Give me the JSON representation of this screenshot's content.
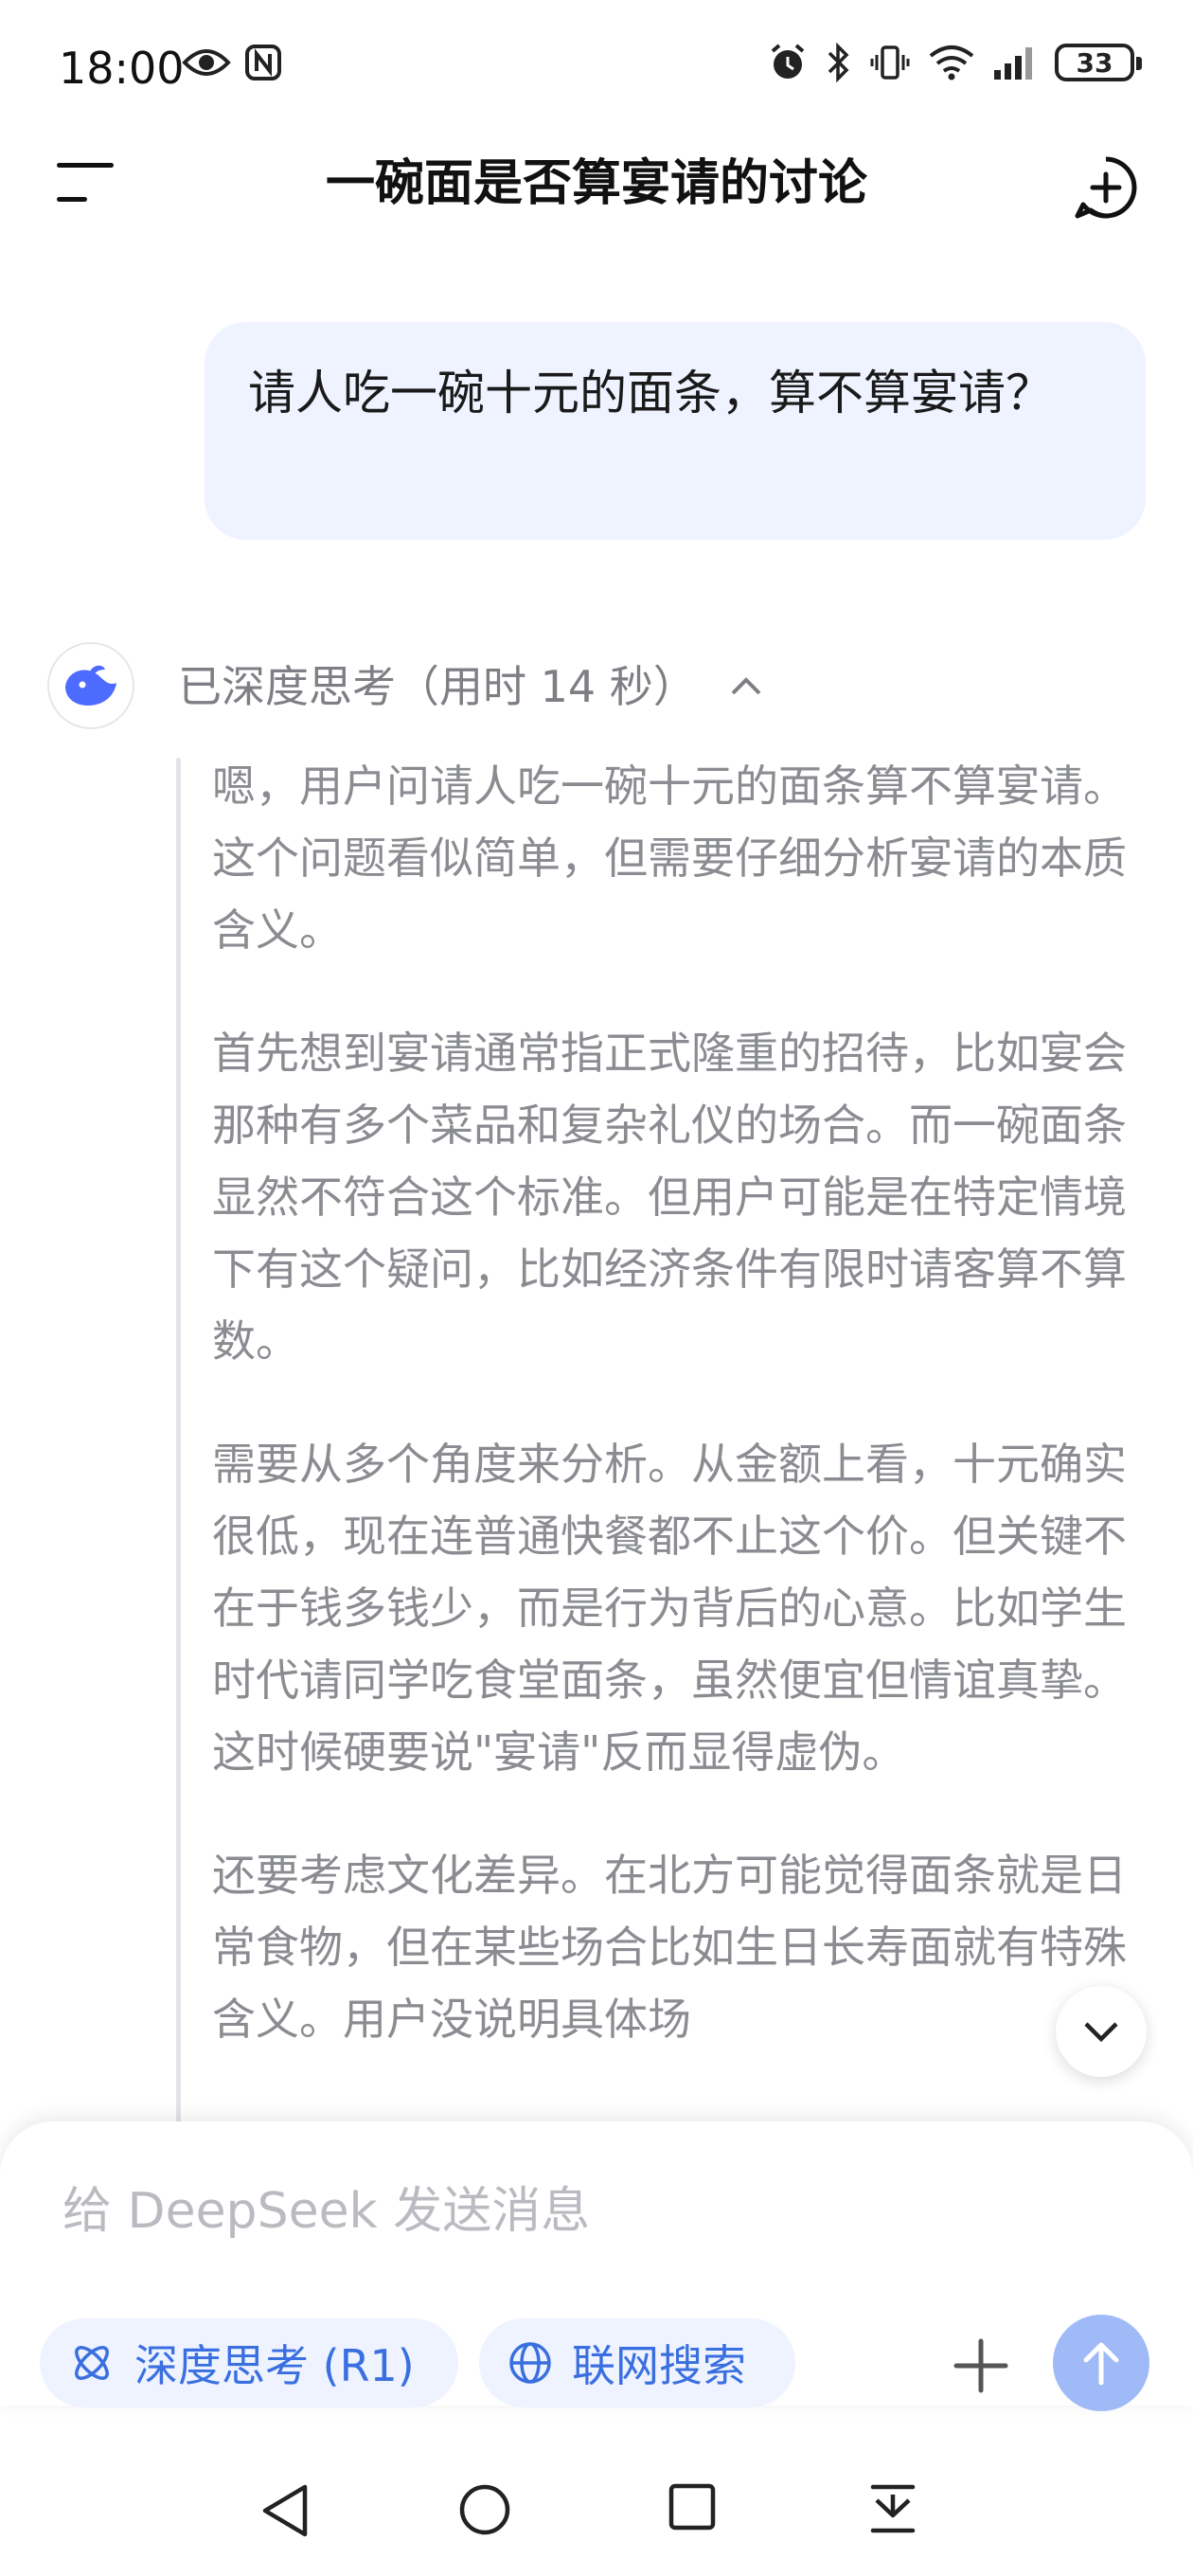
{
  "status_bar": {
    "time": "18:00",
    "battery": "33",
    "icons": [
      "eye-icon",
      "nfc-icon",
      "alarm-icon",
      "bluetooth-icon",
      "vibrate-icon",
      "wifi-icon",
      "signal-icon"
    ]
  },
  "header": {
    "title": "一碗面是否算宴请的讨论",
    "menu_icon": "menu-icon",
    "new_chat_icon": "new-chat-icon"
  },
  "conversation": {
    "user_message": "请人吃一碗十元的面条，算不算宴请？",
    "assistant": {
      "thinking_label": "已深度思考（用时 14 秒）",
      "thinking_paragraphs": [
        "嗯，用户问请人吃一碗十元的面条算不算宴请。这个问题看似简单，但需要仔细分析宴请的本质含义。",
        "首先想到宴请通常指正式隆重的招待，比如宴会那种有多个菜品和复杂礼仪的场合。而一碗面条显然不符合这个标准。但用户可能是在特定情境下有这个疑问，比如经济条件有限时请客算不算数。",
        "需要从多个角度来分析。从金额上看，十元确实很低，现在连普通快餐都不止这个价。但关键不在于钱多钱少，而是行为背后的心意。比如学生时代请同学吃食堂面条，虽然便宜但情谊真挚。这时候硬要说\"宴请\"反而显得虚伪。",
        "还要考虑文化差异。在北方可能觉得面条就是日常食物，但在某些场合比如生日长寿面就有特殊含义。用户没说明具体场"
      ]
    }
  },
  "composer": {
    "placeholder": "给 DeepSeek 发送消息",
    "deep_think_label": "深度思考 (R1)",
    "web_search_label": "联网搜索"
  },
  "colors": {
    "accent": "#3a6fe0",
    "bubble": "#eef3ff",
    "send_button": "#9fbaf7",
    "thinking_text": "#8a8c91"
  }
}
